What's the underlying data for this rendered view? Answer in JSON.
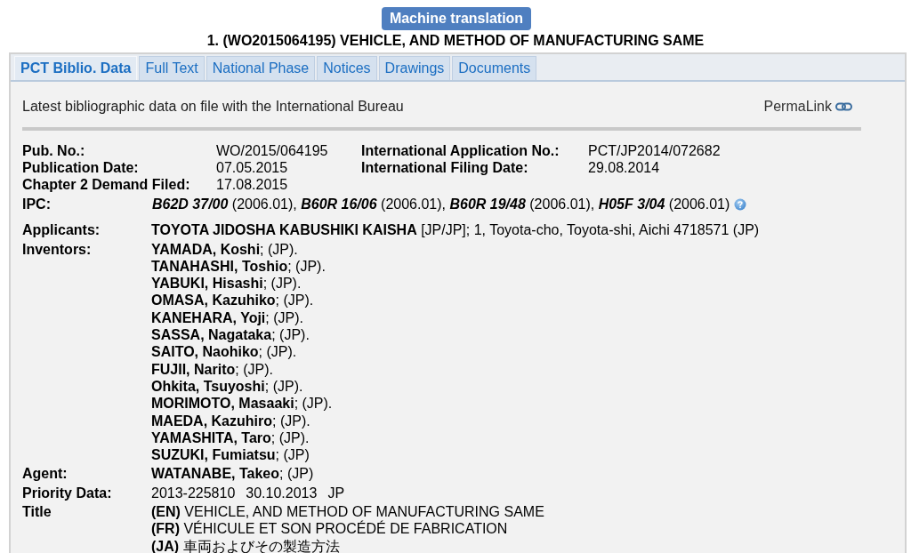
{
  "header": {
    "button": "Machine translation",
    "title": "1. (WO2015064195) VEHICLE, AND METHOD OF MANUFACTURING SAME"
  },
  "tabs": [
    {
      "label": "PCT Biblio. Data",
      "selected": true
    },
    {
      "label": "Full Text",
      "selected": false
    },
    {
      "label": "National Phase",
      "selected": false
    },
    {
      "label": "Notices",
      "selected": false
    },
    {
      "label": "Drawings",
      "selected": false
    },
    {
      "label": "Documents",
      "selected": false
    }
  ],
  "intro": {
    "text": "Latest bibliographic data on file with the International Bureau",
    "permalink": "PermaLink"
  },
  "summary": [
    {
      "label": "Pub. No.:",
      "value": "WO/2015/064195",
      "label_2": "International Application No.:",
      "value_2": "PCT/JP2014/072682"
    },
    {
      "label": "Publication Date:",
      "value": "07.05.2015",
      "label_2": "International Filing Date:",
      "value_2": "29.08.2014"
    },
    {
      "label": "Chapter 2 Demand Filed:",
      "value": "17.08.2015"
    }
  ],
  "details": [
    {
      "kind": "ipc",
      "label": "IPC:",
      "lines": [
        "**B62D 37/00** (2006.01), **B60R 16/06** (2006.01), **B60R 19/48** (2006.01), **H05F 3/04** (2006.01)"
      ]
    },
    {
      "kind": "applicant",
      "label": "Applicants:",
      "lines": [
        "**TOYOTA JIDOSHA KABUSHIKI KAISHA** [JP/JP]; 1, Toyota-cho, Toyota-shi, Aichi 4718571 (JP)"
      ]
    },
    {
      "kind": "inventors",
      "label": "Inventors:",
      "lines": [
        "**YAMADA, Koshi**; (JP).",
        "**TANAHASHI, Toshio**; (JP).",
        "**YABUKI, Hisashi**; (JP).",
        "**OMASA, Kazuhiko**; (JP).",
        "**KANEHARA, Yoji**; (JP).",
        "**SASSA, Nagataka**; (JP).",
        "**SAITO, Naohiko**; (JP).",
        "**FUJII, Narito**; (JP).",
        "**Ohkita, Tsuyoshi**; (JP).",
        "**MORIMOTO, Masaaki**; (JP).",
        "**MAEDA, Kazuhiro**; (JP).",
        "**YAMASHITA, Taro**; (JP).",
        "**SUZUKI, Fumiatsu**; (JP)"
      ]
    },
    {
      "kind": "agent",
      "label": "Agent:",
      "lines": [
        "**WATANABE, Takeo**; (JP)"
      ]
    },
    {
      "kind": "priority",
      "label": "Priority Data:",
      "parts": [
        "2013-225810",
        "30.10.2013",
        "JP"
      ]
    },
    {
      "kind": "title",
      "label": "Title",
      "lines": [
        "**(EN)** VEHICLE, AND METHOD OF MANUFACTURING SAME",
        "**(FR)** VÉHICULE ET SON PROCÉDÉ DE FABRICATION",
        "**(JA)** 車両およびその製造方法"
      ]
    }
  ]
}
